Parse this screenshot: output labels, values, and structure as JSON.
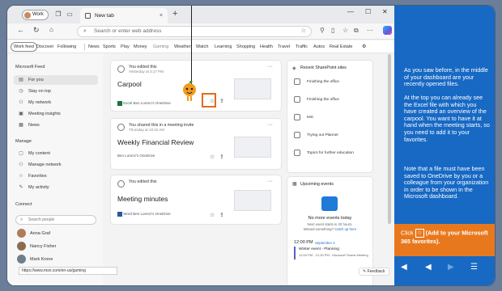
{
  "tabbar": {
    "profile_label": "Work",
    "tab_title": "New tab",
    "new_tab_glyph": "+",
    "close_glyph": "×",
    "minimize_glyph": "—",
    "maximize_glyph": "☐",
    "window_close_glyph": "✕"
  },
  "address": {
    "placeholder": "Search or enter web address"
  },
  "categories": [
    "Work feed",
    "Discover",
    "Following",
    "News",
    "Sports",
    "Play",
    "Money",
    "Gaming",
    "Weather",
    "Watch",
    "Learning",
    "Shopping",
    "Health",
    "Travel",
    "Traffic",
    "Autos",
    "Real Estate"
  ],
  "sidebar": {
    "microsoft_feed_heading": "Microsoft Feed",
    "feed_items": [
      "For you",
      "Stay on top",
      "My network",
      "Meeting insights",
      "News"
    ],
    "manage_heading": "Manage",
    "manage_items": [
      "My content",
      "Manage network",
      "Favorites",
      "My activity"
    ],
    "connect_heading": "Connect",
    "search_placeholder": "Search people",
    "people": [
      "Anna Graf",
      "Nancy Fisher",
      "Mark Krone"
    ]
  },
  "cards": [
    {
      "meta1": "You edited this",
      "meta2": "Yesterday at 3:17 PM",
      "title": "Carpool",
      "app": "Excel",
      "owner": "Ben Lorenz's OneDrive"
    },
    {
      "meta1": "You shared this in a meeting invite",
      "meta2": "Thursday at 10:42 AM",
      "title": "Weekly Financial Review",
      "app": "",
      "owner": "Ben Lorenz's OneDrive"
    },
    {
      "meta1": "You edited this",
      "meta2": "",
      "title": "Meeting minutes",
      "app": "Word",
      "owner": "Ben Lorenz's OneDrive"
    }
  ],
  "sharepoint": {
    "heading": "Recent SharePoint sites",
    "sites": [
      "Finishing the office",
      "Finishing the office",
      "test",
      "Trying out Planner",
      "Topics for further education"
    ]
  },
  "events": {
    "heading": "Upcoming events",
    "empty_title": "No more events today",
    "empty_sub": "Next event starts in 20 hours.",
    "empty_sub2": "Missed something?",
    "catch_up": "Catch up here",
    "time": "12:00 PM",
    "date": "September 4",
    "event_title": "Winter event - Planning",
    "event_sub": "12:00 PM - 12:30 PM · Microsoft Teams Meeting"
  },
  "status_url": "https://www.msn.com/en-us/gaming",
  "feedback_label": "Feedback",
  "panel": {
    "p1": "As you saw before, in the middle of your dashboard are your recently opened files.",
    "p2": "At the top you can already see the Excel file with which you have created an overview of the carpool. You want to have it at hand when the meeting starts, so you need to add it to your favorites.",
    "p3": "Note that a file must have been saved to OneDrive by you or a colleague from your organization in order to be shown in the Microsoft dashboard.",
    "click_prefix": "Click",
    "click_suffix": "(Add to your Microsoft 365 favorites)."
  },
  "colors": {
    "panel_bg": "#1769c4",
    "highlight": "#e36b1c",
    "orange_box": "#e8781e"
  },
  "icons": {
    "panel_nav": [
      "volume-icon",
      "previous-icon",
      "next-icon",
      "menu-icon"
    ]
  }
}
